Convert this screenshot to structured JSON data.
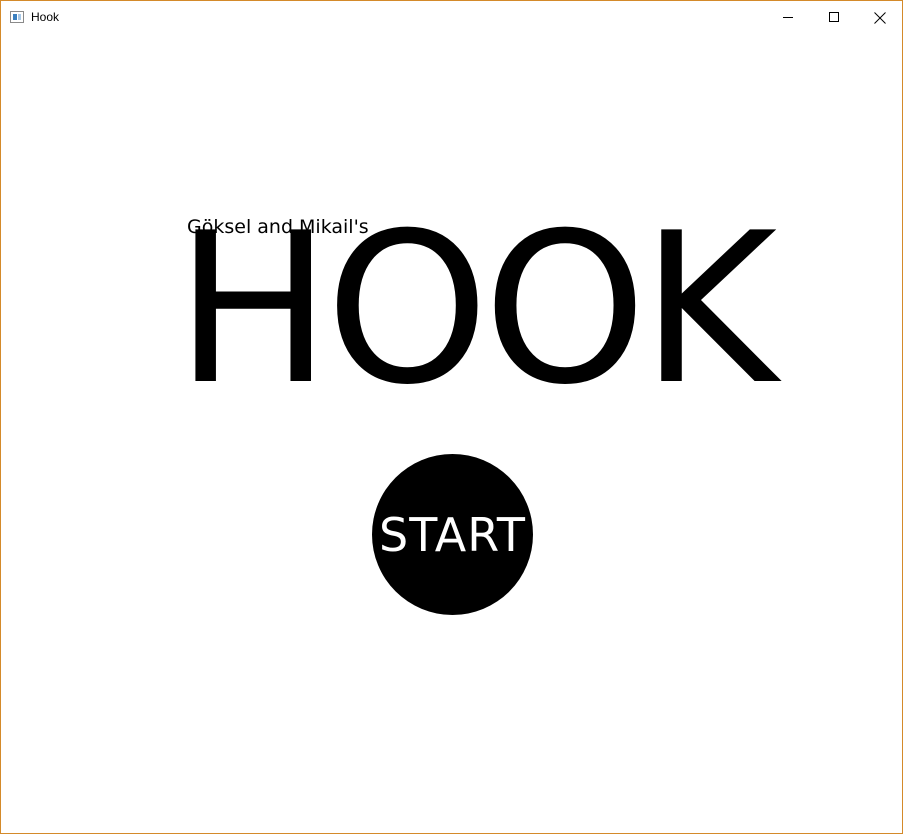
{
  "window": {
    "title": "Hook",
    "controls": {
      "minimize_icon": "minimize-icon",
      "maximize_icon": "maximize-icon",
      "close_icon": "close-icon"
    }
  },
  "main": {
    "subtitle": "Göksel and Mikail's",
    "title": "HOOK",
    "start_label": "START"
  },
  "colors": {
    "background": "#ffffff",
    "text": "#000000",
    "start_button_bg": "#000000",
    "start_button_text": "#ffffff"
  }
}
